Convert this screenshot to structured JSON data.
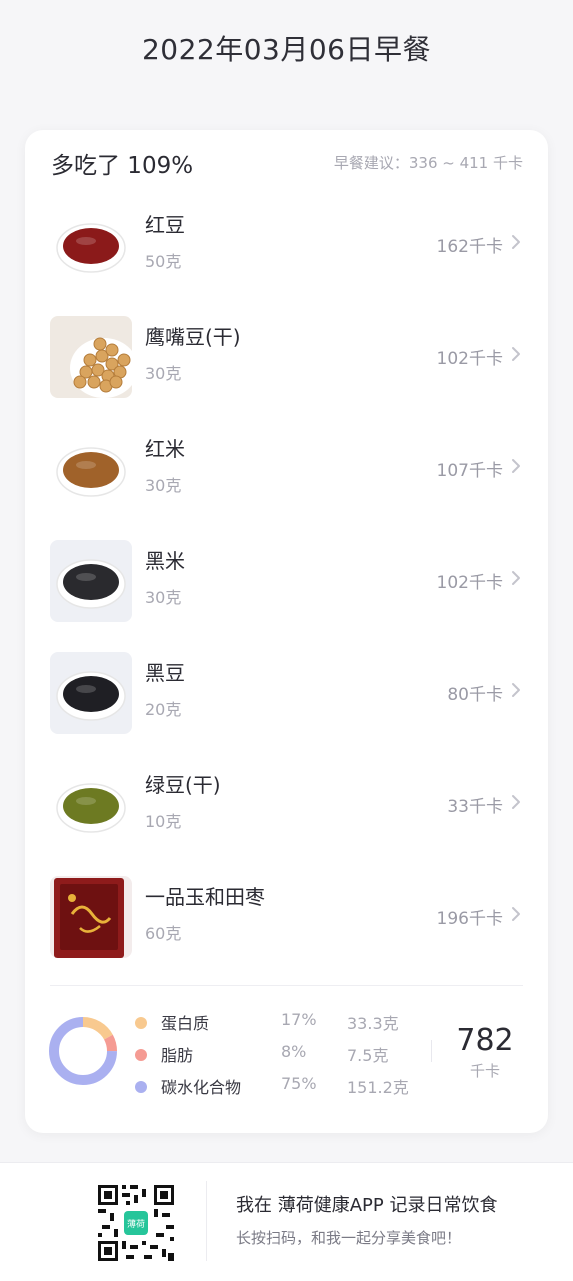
{
  "page": {
    "title": "2022年03月06日早餐"
  },
  "summary": {
    "over_text": "多吃了 109%",
    "suggestion": "早餐建议：336 ~ 411 千卡"
  },
  "items": [
    {
      "name": "红豆",
      "amount": "50克",
      "kcal": "162千卡",
      "thumb_icon": "red-bean-plate-icon",
      "color": "#8b1a1a"
    },
    {
      "name": "鹰嘴豆(干)",
      "amount": "30克",
      "kcal": "102千卡",
      "thumb_icon": "chickpea-bowl-icon",
      "color": "#d9a45e"
    },
    {
      "name": "红米",
      "amount": "30克",
      "kcal": "107千卡",
      "thumb_icon": "red-rice-plate-icon",
      "color": "#a0622a"
    },
    {
      "name": "黑米",
      "amount": "30克",
      "kcal": "102千卡",
      "thumb_icon": "black-rice-plate-icon",
      "color": "#2a2a2e"
    },
    {
      "name": "黑豆",
      "amount": "20克",
      "kcal": "80千卡",
      "thumb_icon": "black-bean-plate-icon",
      "color": "#1f1f24"
    },
    {
      "name": "绿豆(干)",
      "amount": "10克",
      "kcal": "33千卡",
      "thumb_icon": "mung-bean-plate-icon",
      "color": "#6d7a22"
    },
    {
      "name": "一品玉和田枣",
      "amount": "60克",
      "kcal": "196千卡",
      "thumb_icon": "jujube-package-icon",
      "color": "#8e1b1b"
    }
  ],
  "nutrition": {
    "macros": [
      {
        "name": "蛋白质",
        "percent": "17%",
        "grams": "33.3克",
        "color": "#f8c98f",
        "share": 0.17
      },
      {
        "name": "脂肪",
        "percent": "8%",
        "grams": "7.5克",
        "color": "#f59b93",
        "share": 0.08
      },
      {
        "name": "碳水化合物",
        "percent": "75%",
        "grams": "151.2克",
        "color": "#aab0f0",
        "share": 0.75
      }
    ],
    "total": "782",
    "total_unit": "千卡"
  },
  "footer": {
    "line1": "我在 薄荷健康APP 记录日常饮食",
    "line2": "长按扫码，和我一起分享美食吧！",
    "qr_icon": "qr-code-icon",
    "qr_logo_text": "薄荷"
  }
}
